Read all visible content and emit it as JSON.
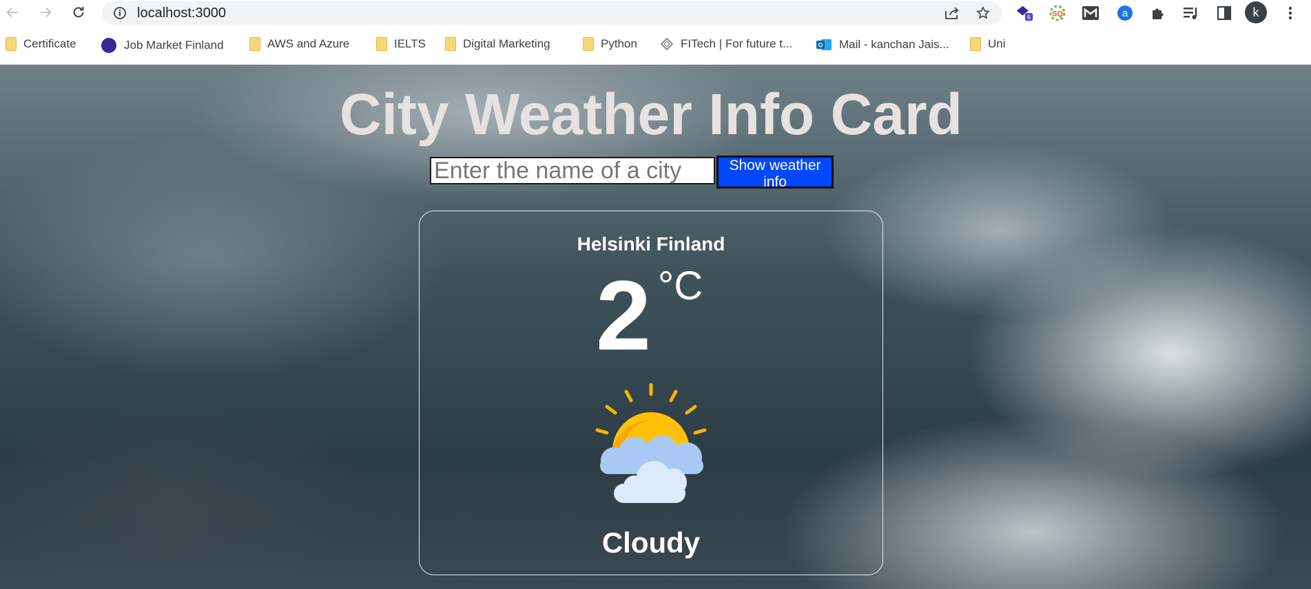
{
  "browser": {
    "url": "localhost:3000",
    "extension_badge": "6",
    "profile_initial": "k",
    "bookmarks": [
      {
        "label": "Certificate",
        "icon": "folder-icon"
      },
      {
        "label": "Job Market Finland",
        "icon": "globe-icon"
      },
      {
        "label": "AWS and Azure",
        "icon": "folder-icon"
      },
      {
        "label": "IELTS",
        "icon": "folder-icon"
      },
      {
        "label": "Digital Marketing",
        "icon": "folder-icon"
      },
      {
        "label": "Python",
        "icon": "folder-icon"
      },
      {
        "label": "FITech | For future t...",
        "icon": "fitech-icon"
      },
      {
        "label": "Mail - kanchan Jais...",
        "icon": "outlook-icon"
      },
      {
        "label": "Uni",
        "icon": "folder-icon"
      }
    ]
  },
  "app": {
    "title": "City Weather Info Card",
    "search": {
      "placeholder": "Enter the name of a city",
      "value": ""
    },
    "button_label": "Show weather info",
    "card": {
      "city": "Helsinki Finland",
      "temperature": "2",
      "unit": "°C",
      "condition": "Cloudy",
      "icon": "sun-behind-cloud-icon"
    }
  },
  "colors": {
    "button": "#0047ff",
    "sun": "#ffc107",
    "cloud": "#a9c9f5"
  }
}
